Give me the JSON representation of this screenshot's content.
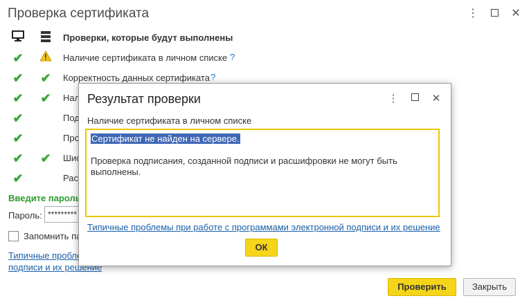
{
  "window": {
    "title": "Проверка сертификата",
    "menu_icon": "⋮",
    "close_icon": "✕"
  },
  "checks": {
    "header": "Проверки, которые будут выполнены",
    "rows": [
      {
        "label": "Наличие сертификата в личном списке",
        "help": "?",
        "local": "check",
        "server": "warning"
      },
      {
        "label": "Корректность данных сертификата",
        "help": "?",
        "local": "check",
        "server": "check"
      },
      {
        "label": "Нал",
        "help": "",
        "local": "check",
        "server": "check"
      },
      {
        "label": "Под",
        "help": "",
        "local": "check",
        "server": "none"
      },
      {
        "label": "Про",
        "help": "",
        "local": "check",
        "server": "none"
      },
      {
        "label": "Шис",
        "help": "",
        "local": "check",
        "server": "check"
      },
      {
        "label": "Рас",
        "help": "",
        "local": "check",
        "server": "none"
      }
    ]
  },
  "password": {
    "heading": "Введите пароль",
    "label": "Пароль:",
    "value": "*********"
  },
  "remember": {
    "label": "Запомнить па"
  },
  "bg_link": {
    "text": "Типичные пробле подписи и их решение"
  },
  "buttons": {
    "verify": "Проверить",
    "close": "Закрыть"
  },
  "dialog": {
    "title": "Результат проверки",
    "subtitle": "Наличие сертификата в личном списке",
    "selected_text": "Сертификат не найден на сервере.",
    "detail_text": "Проверка подписания, созданной подписи и расшифровки не могут быть выполнены.",
    "link": "Типичные проблемы при работе с программами электронной подписи и их решение",
    "ok": "ОК"
  },
  "colors": {
    "accent_button": "#f5d51a",
    "check": "#3aa53a",
    "link": "#1a5fa8",
    "focus_border": "#f0c400"
  }
}
